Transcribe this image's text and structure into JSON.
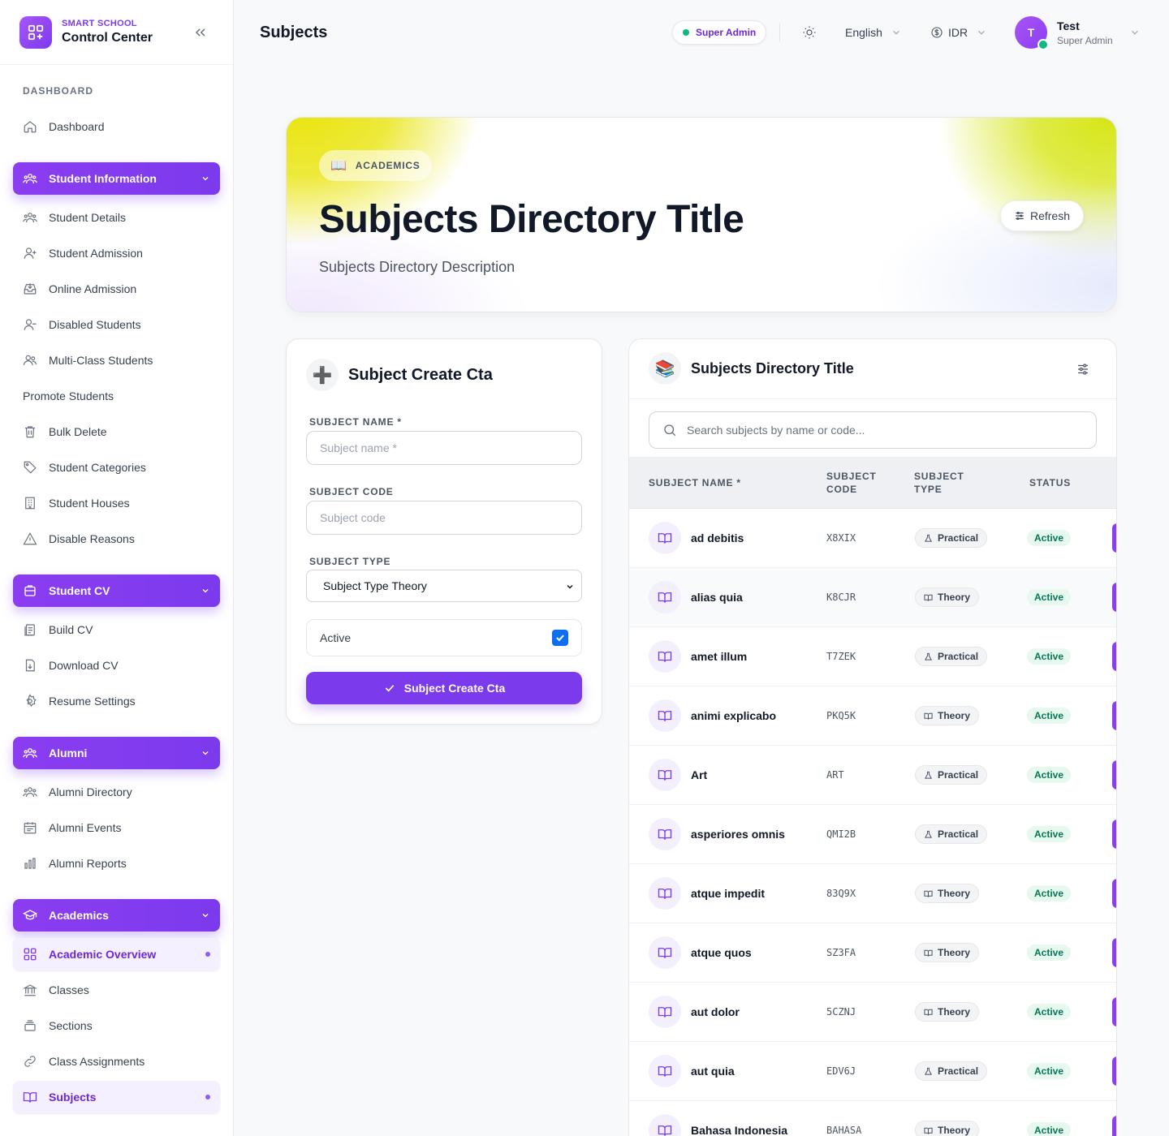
{
  "sidebar": {
    "brand_sub": "SMART SCHOOL",
    "brand_title": "Control Center",
    "section_label": "DASHBOARD",
    "dashboard": "Dashboard",
    "student_information": "Student Information",
    "student_items": [
      "Student Details",
      "Student Admission",
      "Online Admission",
      "Disabled Students",
      "Multi-Class Students",
      "Promote Students",
      "Bulk Delete",
      "Student Categories",
      "Student Houses",
      "Disable Reasons"
    ],
    "student_cv": "Student CV",
    "cv_items": [
      "Build CV",
      "Download CV",
      "Resume Settings"
    ],
    "alumni": "Alumni",
    "alumni_items": [
      "Alumni Directory",
      "Alumni Events",
      "Alumni Reports"
    ],
    "academics": "Academics",
    "academic_items": [
      "Academic Overview",
      "Classes",
      "Sections",
      "Class Assignments",
      "Subjects"
    ]
  },
  "topbar": {
    "title": "Subjects",
    "role_pill": "Super Admin",
    "language": "English",
    "currency": "IDR",
    "user_initial": "T",
    "user_name": "Test",
    "user_role": "Super Admin"
  },
  "hero": {
    "tag_icon": "📖",
    "tag": "ACADEMICS",
    "title": "Subjects Directory Title",
    "description": "Subjects Directory Description",
    "refresh": "Refresh"
  },
  "create": {
    "icon": "➕",
    "title": "Subject Create Cta",
    "name_label": "SUBJECT NAME *",
    "name_placeholder": "Subject name *",
    "code_label": "SUBJECT CODE",
    "code_placeholder": "Subject code",
    "type_label": "SUBJECT TYPE",
    "type_value": "Subject Type Theory",
    "active_label": "Active",
    "active_checked": true,
    "submit": "Subject Create Cta"
  },
  "directory": {
    "icon": "📚",
    "title": "Subjects Directory Title",
    "search_placeholder": "Search subjects by name or code...",
    "columns": {
      "name": "SUBJECT NAME *",
      "code_1": "SUBJECT",
      "code_2": "CODE",
      "type_1": "SUBJECT",
      "type_2": "TYPE",
      "status": "STATUS"
    },
    "rows": [
      {
        "name": "ad debitis",
        "code": "X8XIX",
        "type": "Practical",
        "status": "Active"
      },
      {
        "name": "alias quia",
        "code": "K8CJR",
        "type": "Theory",
        "status": "Active"
      },
      {
        "name": "amet illum",
        "code": "T7ZEK",
        "type": "Practical",
        "status": "Active"
      },
      {
        "name": "animi explicabo",
        "code": "PKQ5K",
        "type": "Theory",
        "status": "Active"
      },
      {
        "name": "Art",
        "code": "ART",
        "type": "Practical",
        "status": "Active"
      },
      {
        "name": "asperiores omnis",
        "code": "QMI2B",
        "type": "Practical",
        "status": "Active"
      },
      {
        "name": "atque impedit",
        "code": "83Q9X",
        "type": "Theory",
        "status": "Active"
      },
      {
        "name": "atque quos",
        "code": "SZ3FA",
        "type": "Theory",
        "status": "Active"
      },
      {
        "name": "aut dolor",
        "code": "5CZNJ",
        "type": "Theory",
        "status": "Active"
      },
      {
        "name": "aut quia",
        "code": "EDV6J",
        "type": "Practical",
        "status": "Active"
      },
      {
        "name": "Bahasa Indonesia",
        "code": "BAHASA",
        "type": "Theory",
        "status": "Active"
      }
    ]
  },
  "colors": {
    "accent": "#7c3aed",
    "success": "#10b981"
  }
}
